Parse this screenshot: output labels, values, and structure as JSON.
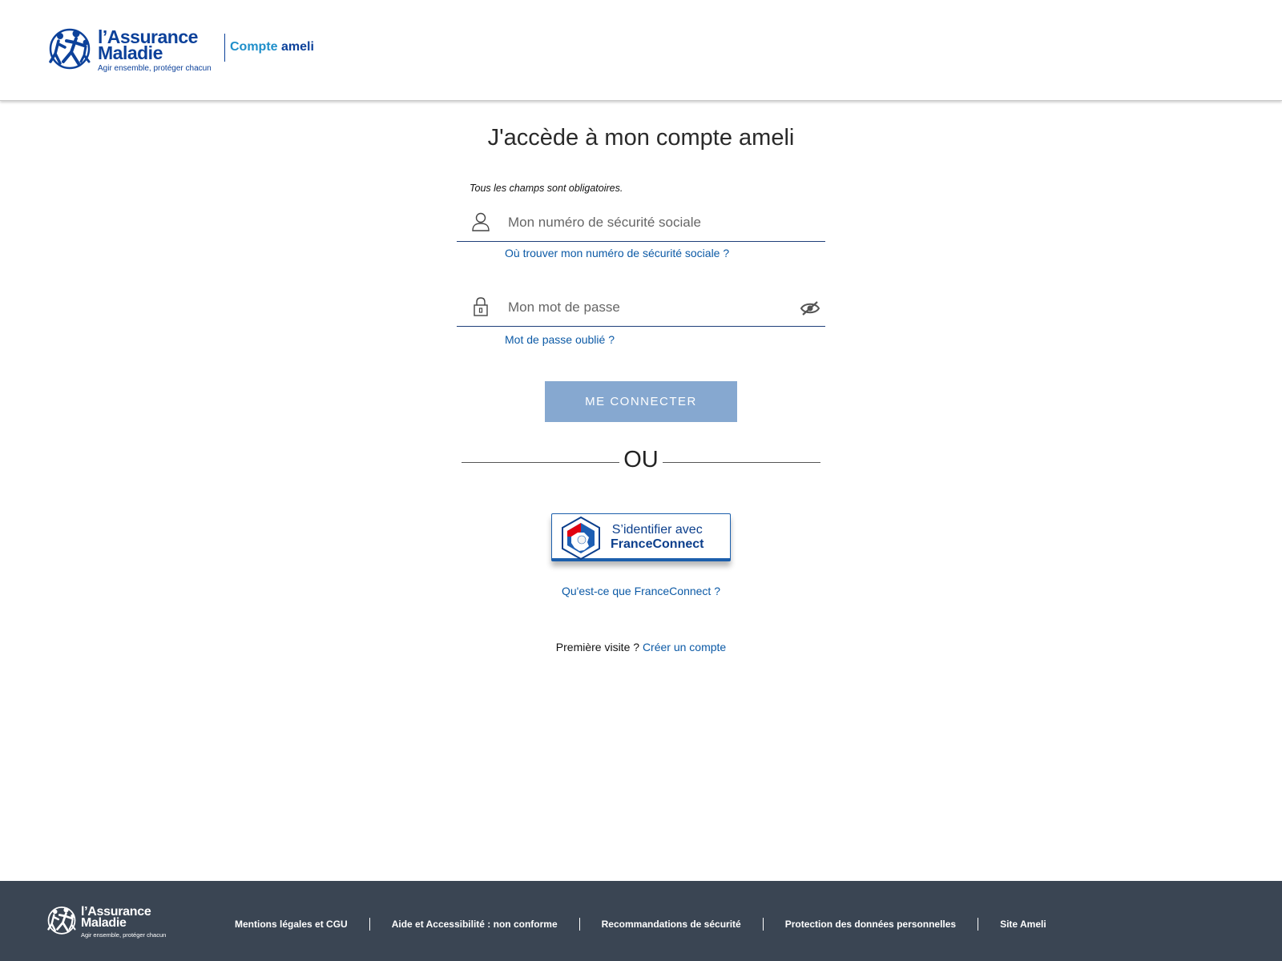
{
  "header": {
    "brand_name_line1": "l’Assurance",
    "brand_name_line2": "Maladie",
    "brand_tagline": "Agir ensemble, protéger chacun",
    "product_part1": "Compte",
    "product_part2": "ameli",
    "logo_icon": "assurance-maladie-logo-icon"
  },
  "main": {
    "title": "J'accède à mon compte ameli",
    "required_note": "Tous les champs sont obligatoires.",
    "ssn": {
      "placeholder": "Mon numéro de sécurité sociale",
      "value": "",
      "icon": "user-icon",
      "help_link": "Où trouver mon numéro de sécurité sociale ?"
    },
    "password": {
      "placeholder": "Mon mot de passe",
      "value": "",
      "icon": "padlock-icon",
      "toggle_icon": "eye-slash-icon",
      "help_link": "Mot de passe oublié ?"
    },
    "connect_button": "ME CONNECTER",
    "or_text": "OU",
    "franceconnect": {
      "line1": "S’identifier avec",
      "line2": "FranceConnect",
      "icon": "franceconnect-logo-icon",
      "help_link": "Qu'est-ce que FranceConnect ?"
    },
    "first_visit_text": "Première visite ?",
    "create_account_link": "Créer un compte"
  },
  "footer": {
    "brand_name_line1": "l’Assurance",
    "brand_name_line2": "Maladie",
    "brand_tagline": "Agir ensemble, protéger chacun",
    "links": [
      "Mentions légales et CGU",
      "Aide et Accessibilité : non conforme",
      "Recommandations de sécurité",
      "Protection des données personnelles",
      "Site Ameli"
    ]
  },
  "colors": {
    "brand_blue": "#0c419a",
    "product_light_blue": "#1f8fca",
    "link_blue": "#0c5aa6",
    "button_disabled": "#86a8d0",
    "footer_bg": "#3a4553"
  }
}
